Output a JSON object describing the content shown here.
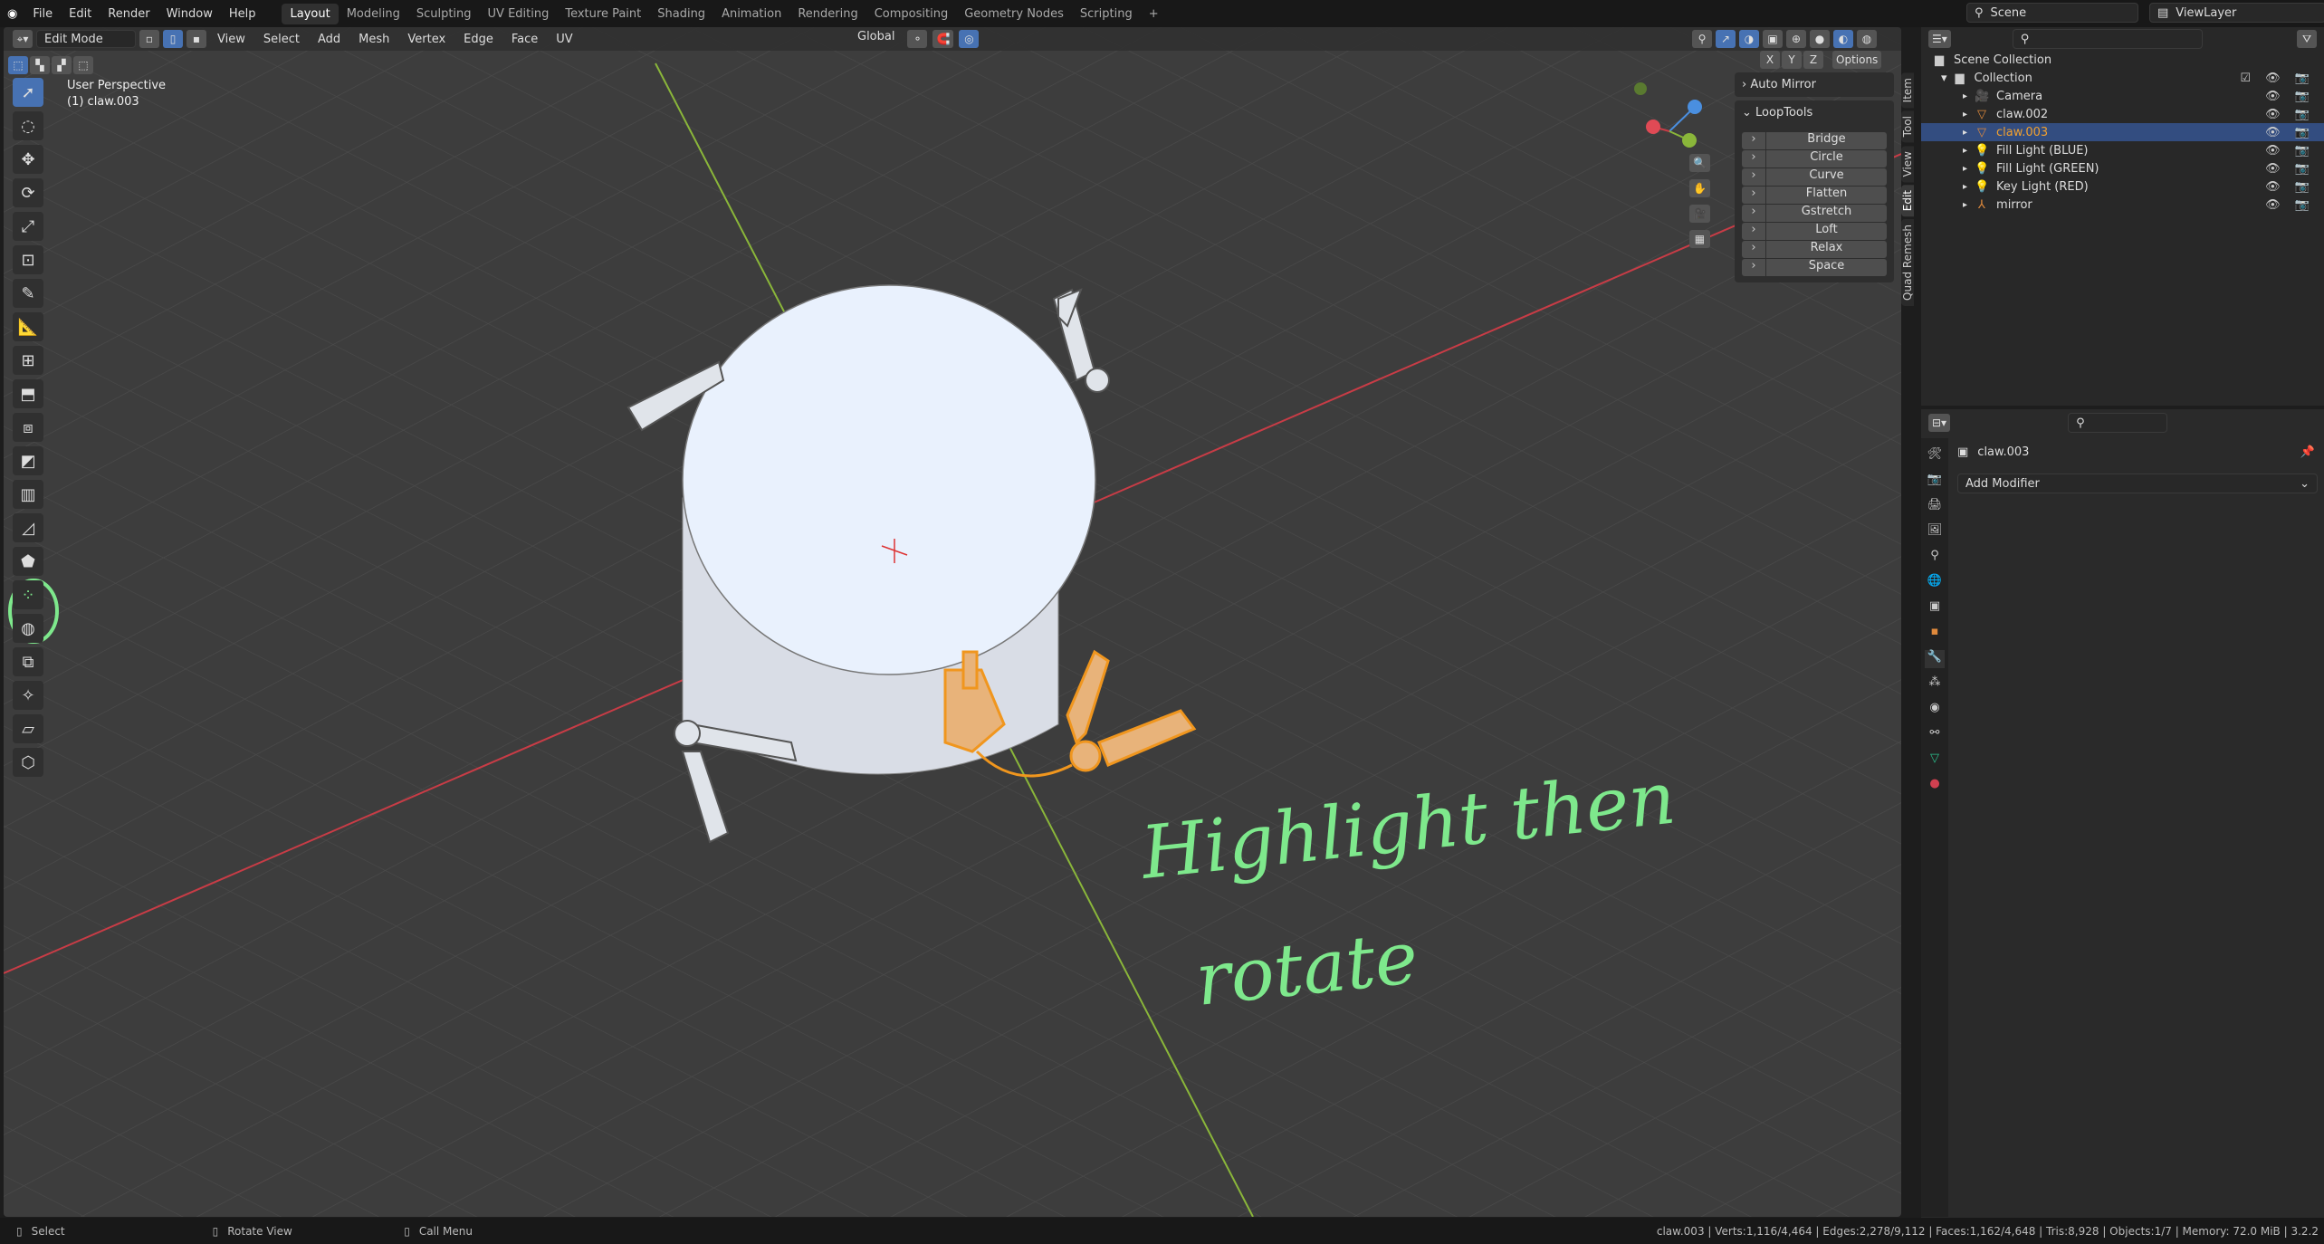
{
  "menu": {
    "items": [
      "File",
      "Edit",
      "Render",
      "Window",
      "Help"
    ],
    "workspaces": [
      "Layout",
      "Modeling",
      "Sculpting",
      "UV Editing",
      "Texture Paint",
      "Shading",
      "Animation",
      "Rendering",
      "Compositing",
      "Geometry Nodes",
      "Scripting"
    ],
    "active_workspace": "Layout",
    "add_label": "+"
  },
  "scene": {
    "scene_name": "Scene",
    "view_layer": "ViewLayer"
  },
  "viewport": {
    "mode": "Edit Mode",
    "menus": [
      "View",
      "Select",
      "Add",
      "Mesh",
      "Vertex",
      "Edge",
      "Face",
      "UV"
    ],
    "transform_orientation": "Global",
    "perspective": "User Perspective",
    "object_label": "(1) claw.003",
    "options_label": "Options",
    "axes": [
      "X",
      "Y",
      "Z"
    ],
    "annotation": {
      "line1": "Highlight  then",
      "line2": "rotate",
      "color": "#7ee88c"
    }
  },
  "npanel": {
    "auto_mirror": "Auto Mirror",
    "looptools": "LoopTools",
    "buttons": [
      "Bridge",
      "Circle",
      "Curve",
      "Flatten",
      "Gstretch",
      "Loft",
      "Relax",
      "Space"
    ],
    "tabs": [
      "Item",
      "Tool",
      "View",
      "Edit",
      "Quad Remesh"
    ],
    "active_tab": "Edit"
  },
  "outliner": {
    "root": "Scene Collection",
    "collection": "Collection",
    "items": [
      {
        "name": "Camera",
        "icon": "camera-icon"
      },
      {
        "name": "claw.002",
        "icon": "mesh-icon"
      },
      {
        "name": "claw.003",
        "icon": "mesh-icon",
        "selected": true
      },
      {
        "name": "Fill Light (BLUE)",
        "icon": "light-icon"
      },
      {
        "name": "Fill Light (GREEN)",
        "icon": "light-icon"
      },
      {
        "name": "Key Light (RED)",
        "icon": "light-icon"
      },
      {
        "name": "mirror",
        "icon": "empty-icon"
      }
    ]
  },
  "properties": {
    "object": "claw.003",
    "add_modifier": "Add Modifier"
  },
  "status": {
    "select": "Select",
    "rotate": "Rotate View",
    "menu": "Call Menu",
    "stats": "claw.003 | Verts:1,116/4,464 | Edges:2,278/9,112 | Faces:1,162/4,648 | Tris:8,928 | Objects:1/7 | Memory: 72.0 MiB | 3.2.2"
  },
  "colors": {
    "accent": "#4772b3",
    "selection": "#f0961e",
    "x_axis": "#c83c46",
    "y_axis": "#8ab63a"
  }
}
